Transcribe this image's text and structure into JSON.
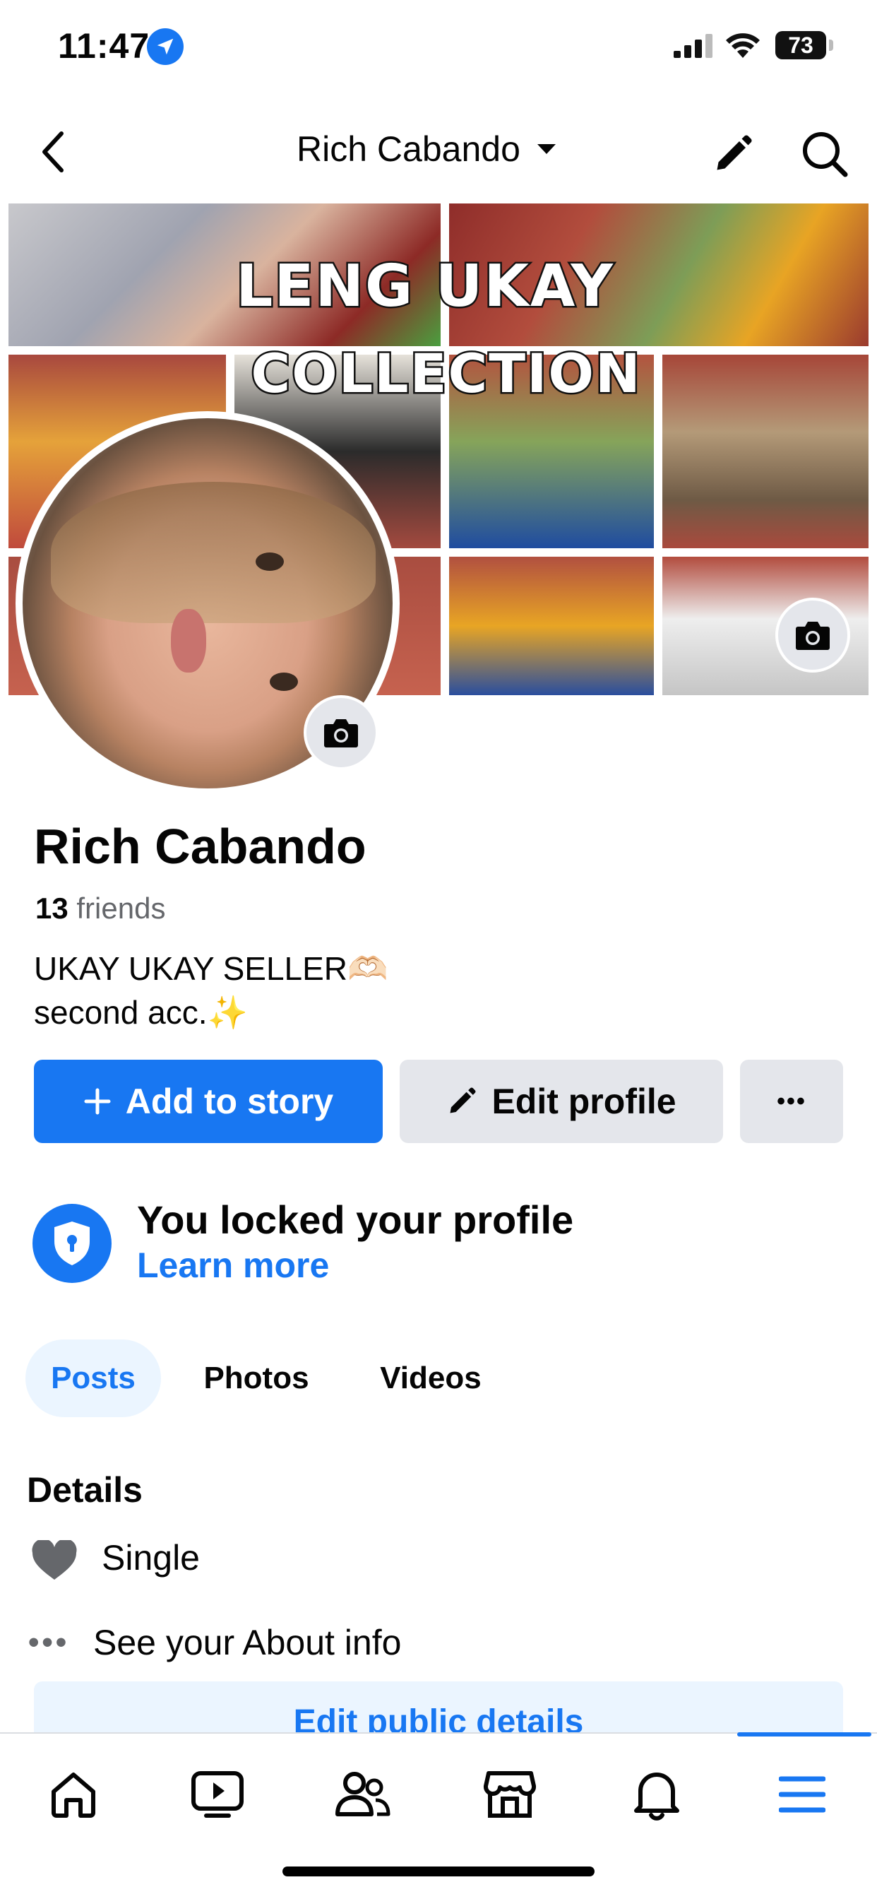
{
  "status_bar": {
    "time": "11:47",
    "battery": "73"
  },
  "header": {
    "title": "Rich Cabando"
  },
  "cover": {
    "title_line1": "LENG UKAY",
    "title_line2": "COLLECTION"
  },
  "profile": {
    "name": "Rich Cabando",
    "friends_count": "13",
    "friends_label": " friends",
    "bio_line1": "UKAY UKAY SELLER🫶🏻",
    "bio_line2": "second acc.✨"
  },
  "actions": {
    "add_story": "Add to story",
    "edit_profile": "Edit profile",
    "more": "•••"
  },
  "locked": {
    "title": "You locked your profile",
    "link": "Learn more"
  },
  "tabs": [
    {
      "label": "Posts",
      "selected": true
    },
    {
      "label": "Photos",
      "selected": false
    },
    {
      "label": "Videos",
      "selected": false
    }
  ],
  "details": {
    "heading": "Details",
    "relationship": "Single",
    "about_dots": "•••",
    "about_link": "See your About info",
    "edit_button": "Edit public details"
  },
  "bottom_nav": {
    "items": [
      "home-icon",
      "video-icon",
      "friends-icon",
      "marketplace-icon",
      "notifications-icon",
      "menu-icon"
    ],
    "active": "menu-icon"
  },
  "colors": {
    "accent": "#1877f2",
    "button_grey": "#e4e6eb",
    "text": "#050505",
    "secondary_text": "#65676b"
  }
}
